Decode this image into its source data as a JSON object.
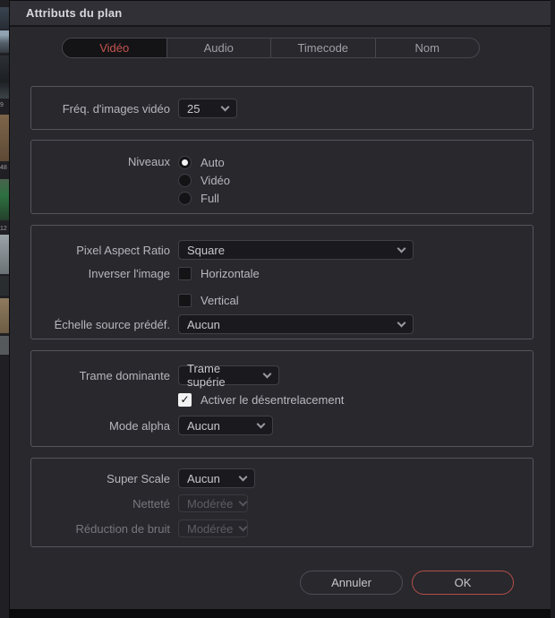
{
  "title_bar": {
    "title": "Attributs du plan"
  },
  "tabs": [
    {
      "label": "Vidéo"
    },
    {
      "label": "Audio"
    },
    {
      "label": "Timecode"
    },
    {
      "label": "Nom"
    }
  ],
  "video": {
    "framerate_label": "Fréq. d'images vidéo",
    "framerate_value": "25",
    "levels_label": "Niveaux",
    "levels_options": [
      "Auto",
      "Vidéo",
      "Full"
    ],
    "levels_selected": "Auto",
    "par_label": "Pixel Aspect Ratio",
    "par_value": "Square",
    "flip_label": "Inverser l'image",
    "flip_horizontal_label": "Horizontale",
    "flip_vertical_label": "Vertical",
    "scale_preset_label": "Échelle source prédéf.",
    "scale_preset_value": "Aucun",
    "field_dominance_label": "Trame dominante",
    "field_dominance_value": "Trame supérie",
    "deinterlace_label": "Activer le désentrelacement",
    "deinterlace_checked": true,
    "alpha_mode_label": "Mode alpha",
    "alpha_mode_value": "Aucun",
    "super_scale_label": "Super Scale",
    "super_scale_value": "Aucun",
    "sharpness_label": "Netteté",
    "sharpness_value": "Modérée",
    "sharpness_enabled": false,
    "noise_reduction_label": "Réduction de bruit",
    "noise_reduction_value": "Modérée",
    "noise_reduction_enabled": false,
    "checkmark_glyph": "✓"
  },
  "footer": {
    "cancel_label": "Annuler",
    "ok_label": "OK"
  },
  "background_strip": {
    "clip_numbers": [
      "9",
      "48",
      "12"
    ]
  },
  "colors": {
    "accent_red": "#c4544d",
    "ok_border_red": "#b44f49",
    "dialog_bg": "#28282d",
    "titlebar_bg": "#303036",
    "section_border": "#55555c",
    "control_bg": "#1a1a1e"
  }
}
